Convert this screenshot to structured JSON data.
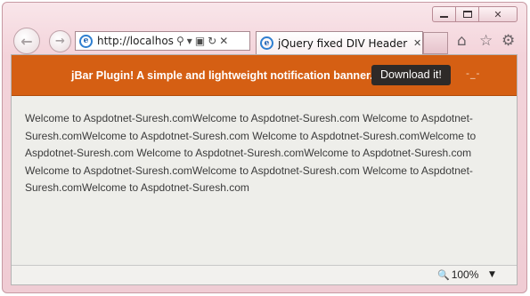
{
  "browser": {
    "address": {
      "url": "http://localhost:"
    },
    "tab": {
      "title": "jQuery fixed DIV Header N..."
    },
    "icons": {
      "back": "back-arrow-icon",
      "forward": "forward-arrow-icon",
      "home": "home-icon",
      "favorites": "star-icon",
      "tools": "gear-icon"
    },
    "glyphs": {
      "back": "←",
      "forward": "→",
      "search": "⚲",
      "dropdown": "▾",
      "compat": "▣",
      "refresh": "↻",
      "stop": "✕",
      "ie": "e",
      "tab_close": "✕",
      "home": "⌂",
      "star": "☆",
      "gear": "⚙",
      "close": "✕",
      "zoom_dropdown": "▼",
      "zoom_icon": "🔍"
    }
  },
  "page": {
    "banner": {
      "text": "jBar Plugin! A simple and lightweight notification banner.",
      "button_label": "Download it!",
      "hide_glyph": "-_-",
      "color": "#d55f13"
    },
    "body_text": "Welcome to Aspdotnet-Suresh.comWelcome to Aspdotnet-Suresh.com Welcome to Aspdotnet-Suresh.comWelcome to Aspdotnet-Suresh.com Welcome to Aspdotnet-Suresh.comWelcome to Aspdotnet-Suresh.com Welcome to Aspdotnet-Suresh.comWelcome to Aspdotnet-Suresh.com Welcome to Aspdotnet-Suresh.comWelcome to Aspdotnet-Suresh.com Welcome to Aspdotnet-Suresh.comWelcome to Aspdotnet-Suresh.com"
  },
  "status": {
    "zoom": "100%"
  }
}
